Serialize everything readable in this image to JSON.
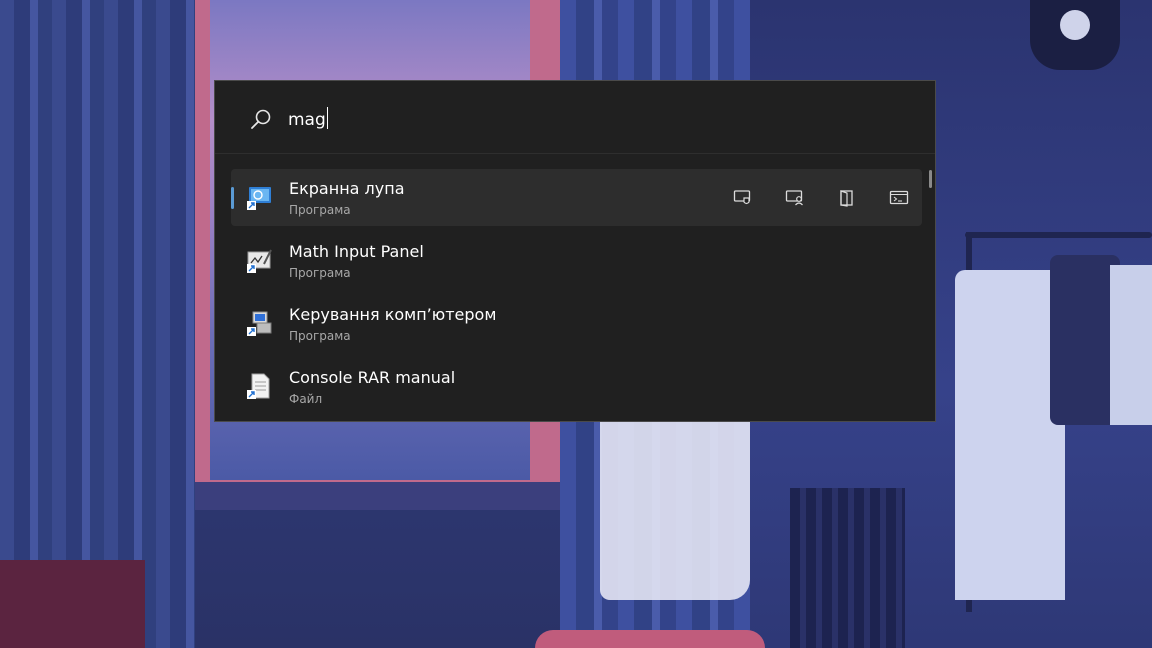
{
  "search": {
    "query": "mag"
  },
  "results": [
    {
      "title": "Екранна лупа",
      "subtitle": "Програма",
      "icon": "magnifier-app-icon",
      "selected": true
    },
    {
      "title": "Math Input Panel",
      "subtitle": "Програма",
      "icon": "math-input-app-icon",
      "selected": false
    },
    {
      "title": "Керування комп’ютером",
      "subtitle": "Програма",
      "icon": "computer-management-app-icon",
      "selected": false
    },
    {
      "title": "Console RAR manual",
      "subtitle": "Файл",
      "icon": "document-file-icon",
      "selected": false
    }
  ],
  "actions": [
    {
      "icon": "run-as-admin-icon"
    },
    {
      "icon": "run-as-other-user-icon"
    },
    {
      "icon": "open-file-location-icon"
    },
    {
      "icon": "open-console-icon"
    }
  ],
  "colors": {
    "panel_bg": "#202020",
    "selected_row_bg": "#2d2d2d",
    "accent": "#5b9bd5",
    "subtitle": "#a8a8a8"
  }
}
